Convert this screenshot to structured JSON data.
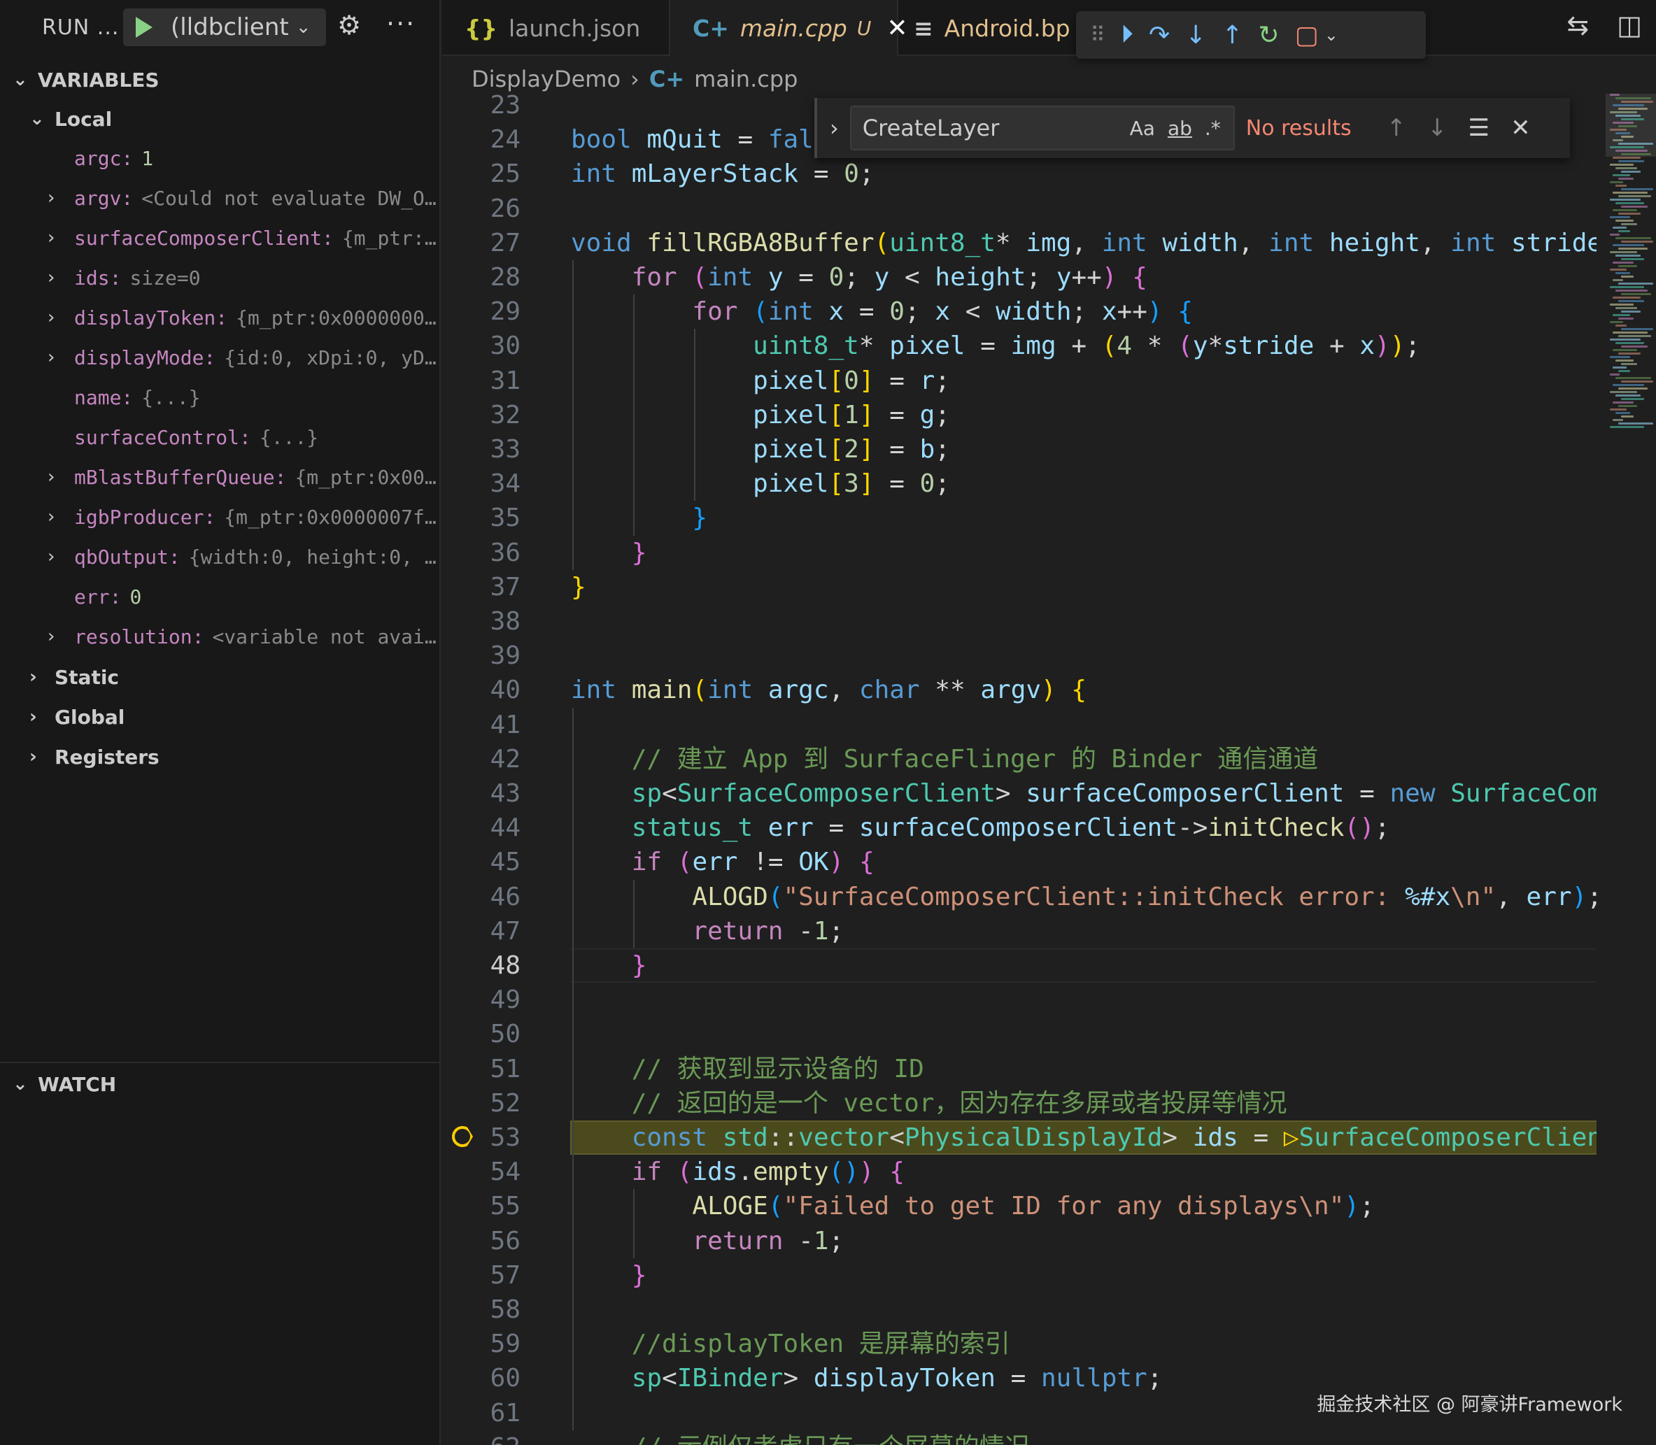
{
  "run": {
    "label": "RUN ...",
    "config": "(lldbclient",
    "chevron": "⌄"
  },
  "variables": {
    "header": "VARIABLES",
    "local_label": "Local",
    "items": [
      {
        "name": "argc:",
        "value": "1",
        "expandable": false,
        "kind": "num"
      },
      {
        "name": "argv:",
        "value": "<Could not evaluate DW_O…",
        "expandable": true,
        "kind": "gray"
      },
      {
        "name": "surfaceComposerClient:",
        "value": "{m_ptr:…",
        "expandable": true,
        "kind": "gray"
      },
      {
        "name": "ids:",
        "value": "size=0",
        "expandable": true,
        "kind": "gray"
      },
      {
        "name": "displayToken:",
        "value": "{m_ptr:0x0000000…",
        "expandable": true,
        "kind": "gray"
      },
      {
        "name": "displayMode:",
        "value": "{id:0, xDpi:0, yD…",
        "expandable": true,
        "kind": "gray"
      },
      {
        "name": "name:",
        "value": "{...}",
        "expandable": false,
        "kind": "gray"
      },
      {
        "name": "surfaceControl:",
        "value": "{...}",
        "expandable": false,
        "kind": "gray"
      },
      {
        "name": "mBlastBufferQueue:",
        "value": "{m_ptr:0x00…",
        "expandable": true,
        "kind": "gray"
      },
      {
        "name": "igbProducer:",
        "value": "{m_ptr:0x0000007f…",
        "expandable": true,
        "kind": "gray"
      },
      {
        "name": "qbOutput:",
        "value": "{width:0, height:0, …",
        "expandable": true,
        "kind": "gray"
      },
      {
        "name": "err:",
        "value": "0",
        "expandable": false,
        "kind": "num"
      },
      {
        "name": "resolution:",
        "value": "<variable not avai…",
        "expandable": true,
        "kind": "gray"
      }
    ],
    "groups": [
      "Static",
      "Global",
      "Registers"
    ]
  },
  "watch": {
    "header": "WATCH"
  },
  "tabs": [
    {
      "icon": "{}",
      "label": "launch.json",
      "active": false
    },
    {
      "icon": "C+",
      "label": "main.cpp",
      "mod": "U",
      "active": true
    },
    {
      "icon": "≡",
      "label": "Android.bp",
      "active": false
    }
  ],
  "breadcrumb": {
    "folder": "DisplayDemo",
    "file": "main.cpp"
  },
  "find": {
    "value": "CreateLayer",
    "opt_case": "Aa",
    "opt_word": "ab",
    "opt_regex": ".*",
    "status": "No results"
  },
  "editor": {
    "first_line": 23,
    "current_line": 48,
    "breakpoint_line": 53,
    "lines": [
      "",
      "<k>bool</k> <v>mQuit</v> <p>=</p> <k>fal</k>",
      "<k>int</k> <v>mLayerStack</v> <p>=</p> <n>0</n><p>;</p>",
      "",
      "<k>void</k> <f>fillRGBA8Buffer</f><b1>(</b1><t>uint8_t</t><p>*</p> <v>img</v><p>,</p> <k>int</k> <v>width</v><p>,</p> <k>int</k> <v>height</v><p>,</p> <k>int</k> <v>stride</v>",
      "    <c>for</c> <b2>(</b2><k>int</k> <v>y</v> <p>=</p> <n>0</n><p>;</p> <v>y</v> <p>&lt;</p> <v>height</v><p>;</p> <v>y</v><p>++</p><b2>)</b2> <b2>{</b2>",
      "        <c>for</c> <b3>(</b3><k>int</k> <v>x</v> <p>=</p> <n>0</n><p>;</p> <v>x</v> <p>&lt;</p> <v>width</v><p>;</p> <v>x</v><p>++</p><b3>)</b3> <b3>{</b3>",
      "            <t>uint8_t</t><p>*</p> <v>pixel</v> <p>=</p> <v>img</v> <p>+</p> <b1>(</b1><n>4</n> <p>*</p> <b2>(</b2><v>y</v><p>*</p><v>stride</v> <p>+</p> <v>x</v><b2>)</b2><b1>)</b1><p>;</p>",
      "            <v>pixel</v><b1>[</b1><n>0</n><b1>]</b1> <p>=</p> <v>r</v><p>;</p>",
      "            <v>pixel</v><b1>[</b1><n>1</n><b1>]</b1> <p>=</p> <v>g</v><p>;</p>",
      "            <v>pixel</v><b1>[</b1><n>2</n><b1>]</b1> <p>=</p> <v>b</v><p>;</p>",
      "            <v>pixel</v><b1>[</b1><n>3</n><b1>]</b1> <p>=</p> <n>0</n><p>;</p>",
      "        <b3>}</b3>",
      "    <b2>}</b2>",
      "<b1>}</b1>",
      "",
      "",
      "<k>int</k> <f>main</f><b1>(</b1><k>int</k> <v>argc</v><p>,</p> <k>char</k> <p>**</p> <v>argv</v><b1>)</b1> <b1>{</b1>",
      "",
      "    <m>// 建立 App 到 SurfaceFlinger 的 Binder 通信通道</m>",
      "    <t>sp</t><p>&lt;</p><t>SurfaceComposerClient</t><p>&gt;</p> <v>surfaceComposerClient</v> <p>=</p> <k>new</k> <t>SurfaceComposerClient</t>",
      "    <t>status_t</t> <v>err</v> <p>=</p> <v>surfaceComposerClient</v><p>-&gt;</p><f>initCheck</f><b2>()</b2><p>;</p>",
      "    <c>if</c> <b2>(</b2><v>err</v> <p>!=</p> <v>OK</v><b2>)</b2> <b2>{</b2>",
      "        <f>ALOGD</f><b3>(</b3><s>\"SurfaceComposerClient::initCheck error: </s><v>%#x</v><s>\\n\"</s><p>,</p> <v>err</v><b3>)</b3><p>;</p>",
      "        <c>return</c> <p>-</p><n>1</n><p>;</p>",
      "    <b2>}</b2>",
      "",
      "",
      "    <m>// 获取到显示设备的 ID</m>",
      "    <m>// 返回的是一个 vector，因为存在多屏或者投屏等情况</m>",
      "    <k>const</k> <t>std</t><p>::</p><t>vector</t><p>&lt;</p><t>PhysicalDisplayId</t><p>&gt;</p> <v>ids</v> <p>=</p> <b1>▷</b1><t>SurfaceComposerClient</t>",
      "    <c>if</c> <b2>(</b2><v>ids</v><p>.</p><f>empty</f><b3>()</b3><b2>)</b2> <b2>{</b2>",
      "        <f>ALOGE</f><b3>(</b3><s>\"Failed to get ID for any displays\\n\"</s><b3>)</b3><p>;</p>",
      "        <c>return</c> <p>-</p><n>1</n><p>;</p>",
      "    <b2>}</b2>",
      "",
      "    <m>//displayToken 是屏幕的索引</m>",
      "    <t>sp</t><p>&lt;</p><t>IBinder</t><p>&gt;</p> <v>displayToken</v> <p>=</p> <k>nullptr</k><p>;</p>",
      "",
      "    <m>// 示例仅考虑只有一个屏幕的情况</m>"
    ]
  },
  "watermark": "掘金技术社区 @ 阿豪讲Framework",
  "colors": {
    "background": "#1f1f1f",
    "sidebar": "#181818",
    "highlight_line": "#4b4a1d",
    "breakpoint": "#ffcc00",
    "error_text": "#f48771"
  }
}
